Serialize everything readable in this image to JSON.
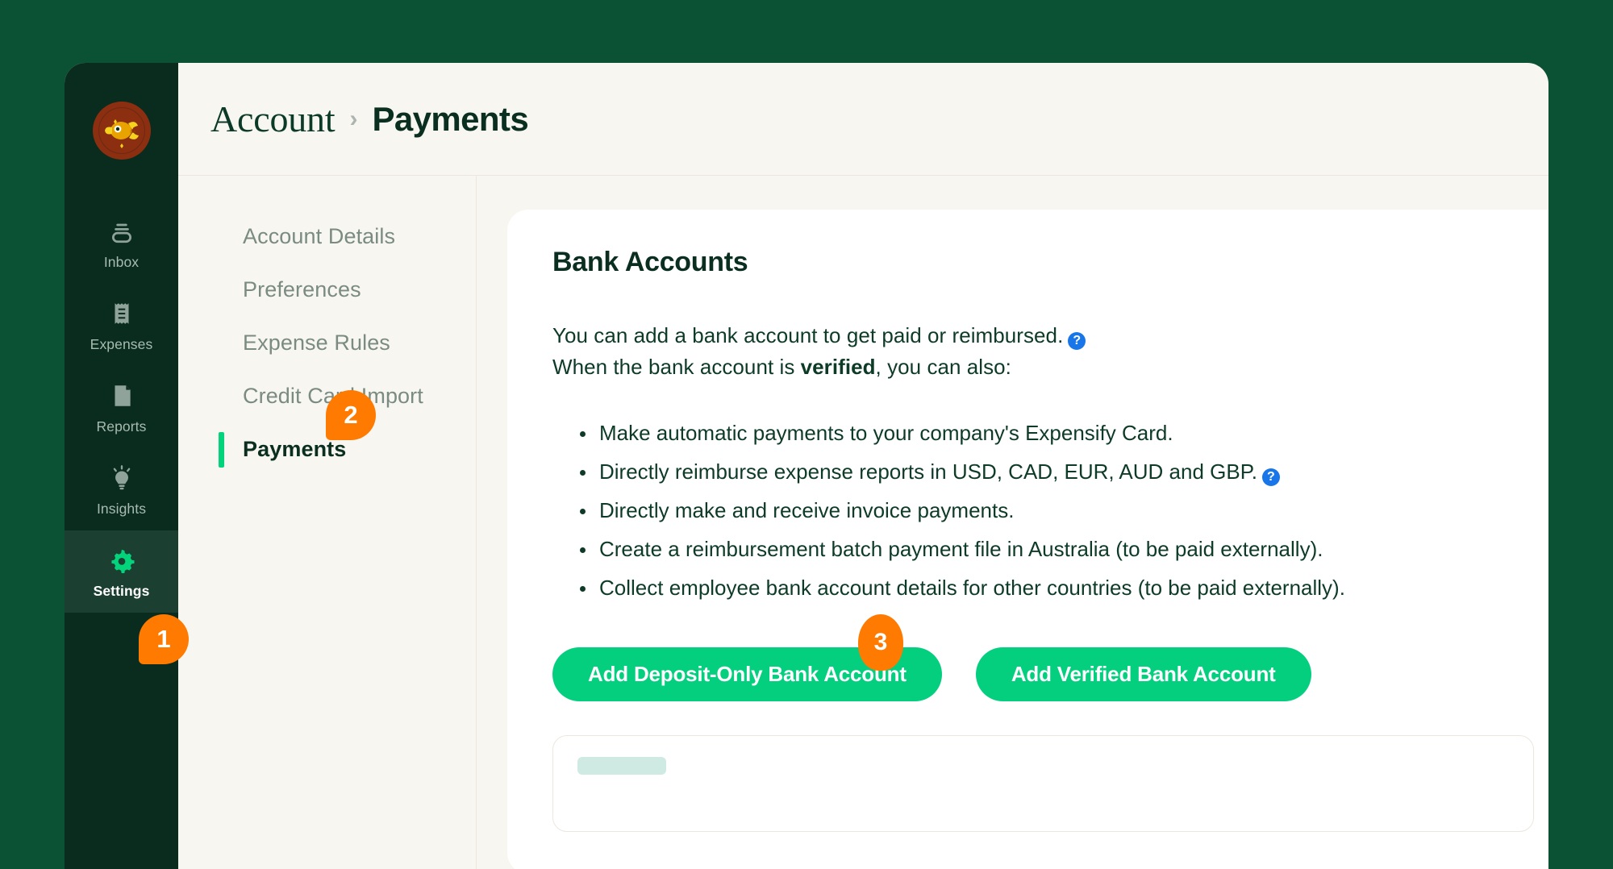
{
  "colors": {
    "page_background": "#0A5233",
    "sidebar_background": "#092C1E",
    "app_background": "#F8F6F1",
    "card_background": "#FFFFFF",
    "accent_green": "#03CF7E",
    "active_bar_green": "#03D47C",
    "badge_orange": "#FF7A00",
    "help_blue": "#1976E8",
    "heading_green": "#0A2E1F",
    "muted_text": "#7A8B82"
  },
  "sidebar": {
    "avatar": {
      "icon": "fish-avatar",
      "circle_color": "#8C2E10",
      "fish_color": "#F2B705"
    },
    "items": [
      {
        "label": "Inbox",
        "icon": "inbox-icon",
        "active": false
      },
      {
        "label": "Expenses",
        "icon": "receipt-icon",
        "active": false
      },
      {
        "label": "Reports",
        "icon": "document-icon",
        "active": false
      },
      {
        "label": "Insights",
        "icon": "lightbulb-icon",
        "active": false
      },
      {
        "label": "Settings",
        "icon": "gear-icon",
        "active": true
      }
    ]
  },
  "header": {
    "breadcrumb": {
      "parent": "Account",
      "separator": "›",
      "current": "Payments"
    }
  },
  "subnav": {
    "items": [
      {
        "label": "Account Details",
        "active": false
      },
      {
        "label": "Preferences",
        "active": false
      },
      {
        "label": "Expense Rules",
        "active": false
      },
      {
        "label": "Credit Card Import",
        "active": false
      },
      {
        "label": "Payments",
        "active": true
      }
    ]
  },
  "main": {
    "card_title": "Bank Accounts",
    "intro_line_1": "You can add a bank account to get paid or reimbursed.",
    "intro_line_2_prefix": "When the bank account is ",
    "intro_line_2_bold": "verified",
    "intro_line_2_suffix": ", you can also:",
    "help_icon_glyph": "?",
    "benefits": [
      {
        "text": "Make automatic payments to your company's Expensify Card.",
        "help": false
      },
      {
        "text": "Directly reimburse expense reports in USD, CAD, EUR, AUD and GBP.",
        "help": true
      },
      {
        "text": "Directly make and receive invoice payments.",
        "help": false
      },
      {
        "text": "Create a reimbursement batch payment file in Australia (to be paid externally).",
        "help": false
      },
      {
        "text": "Collect employee bank account details for other countries (to be paid externally).",
        "help": false
      }
    ],
    "buttons": [
      {
        "label": "Add Deposit-Only Bank Account"
      },
      {
        "label": "Add Verified Bank Account"
      }
    ]
  },
  "step_badges": [
    {
      "number": "1",
      "target": "sidebar-item-settings"
    },
    {
      "number": "2",
      "target": "subnav-item-payments"
    },
    {
      "number": "3",
      "target": "add-verified-bank-account-button"
    }
  ]
}
